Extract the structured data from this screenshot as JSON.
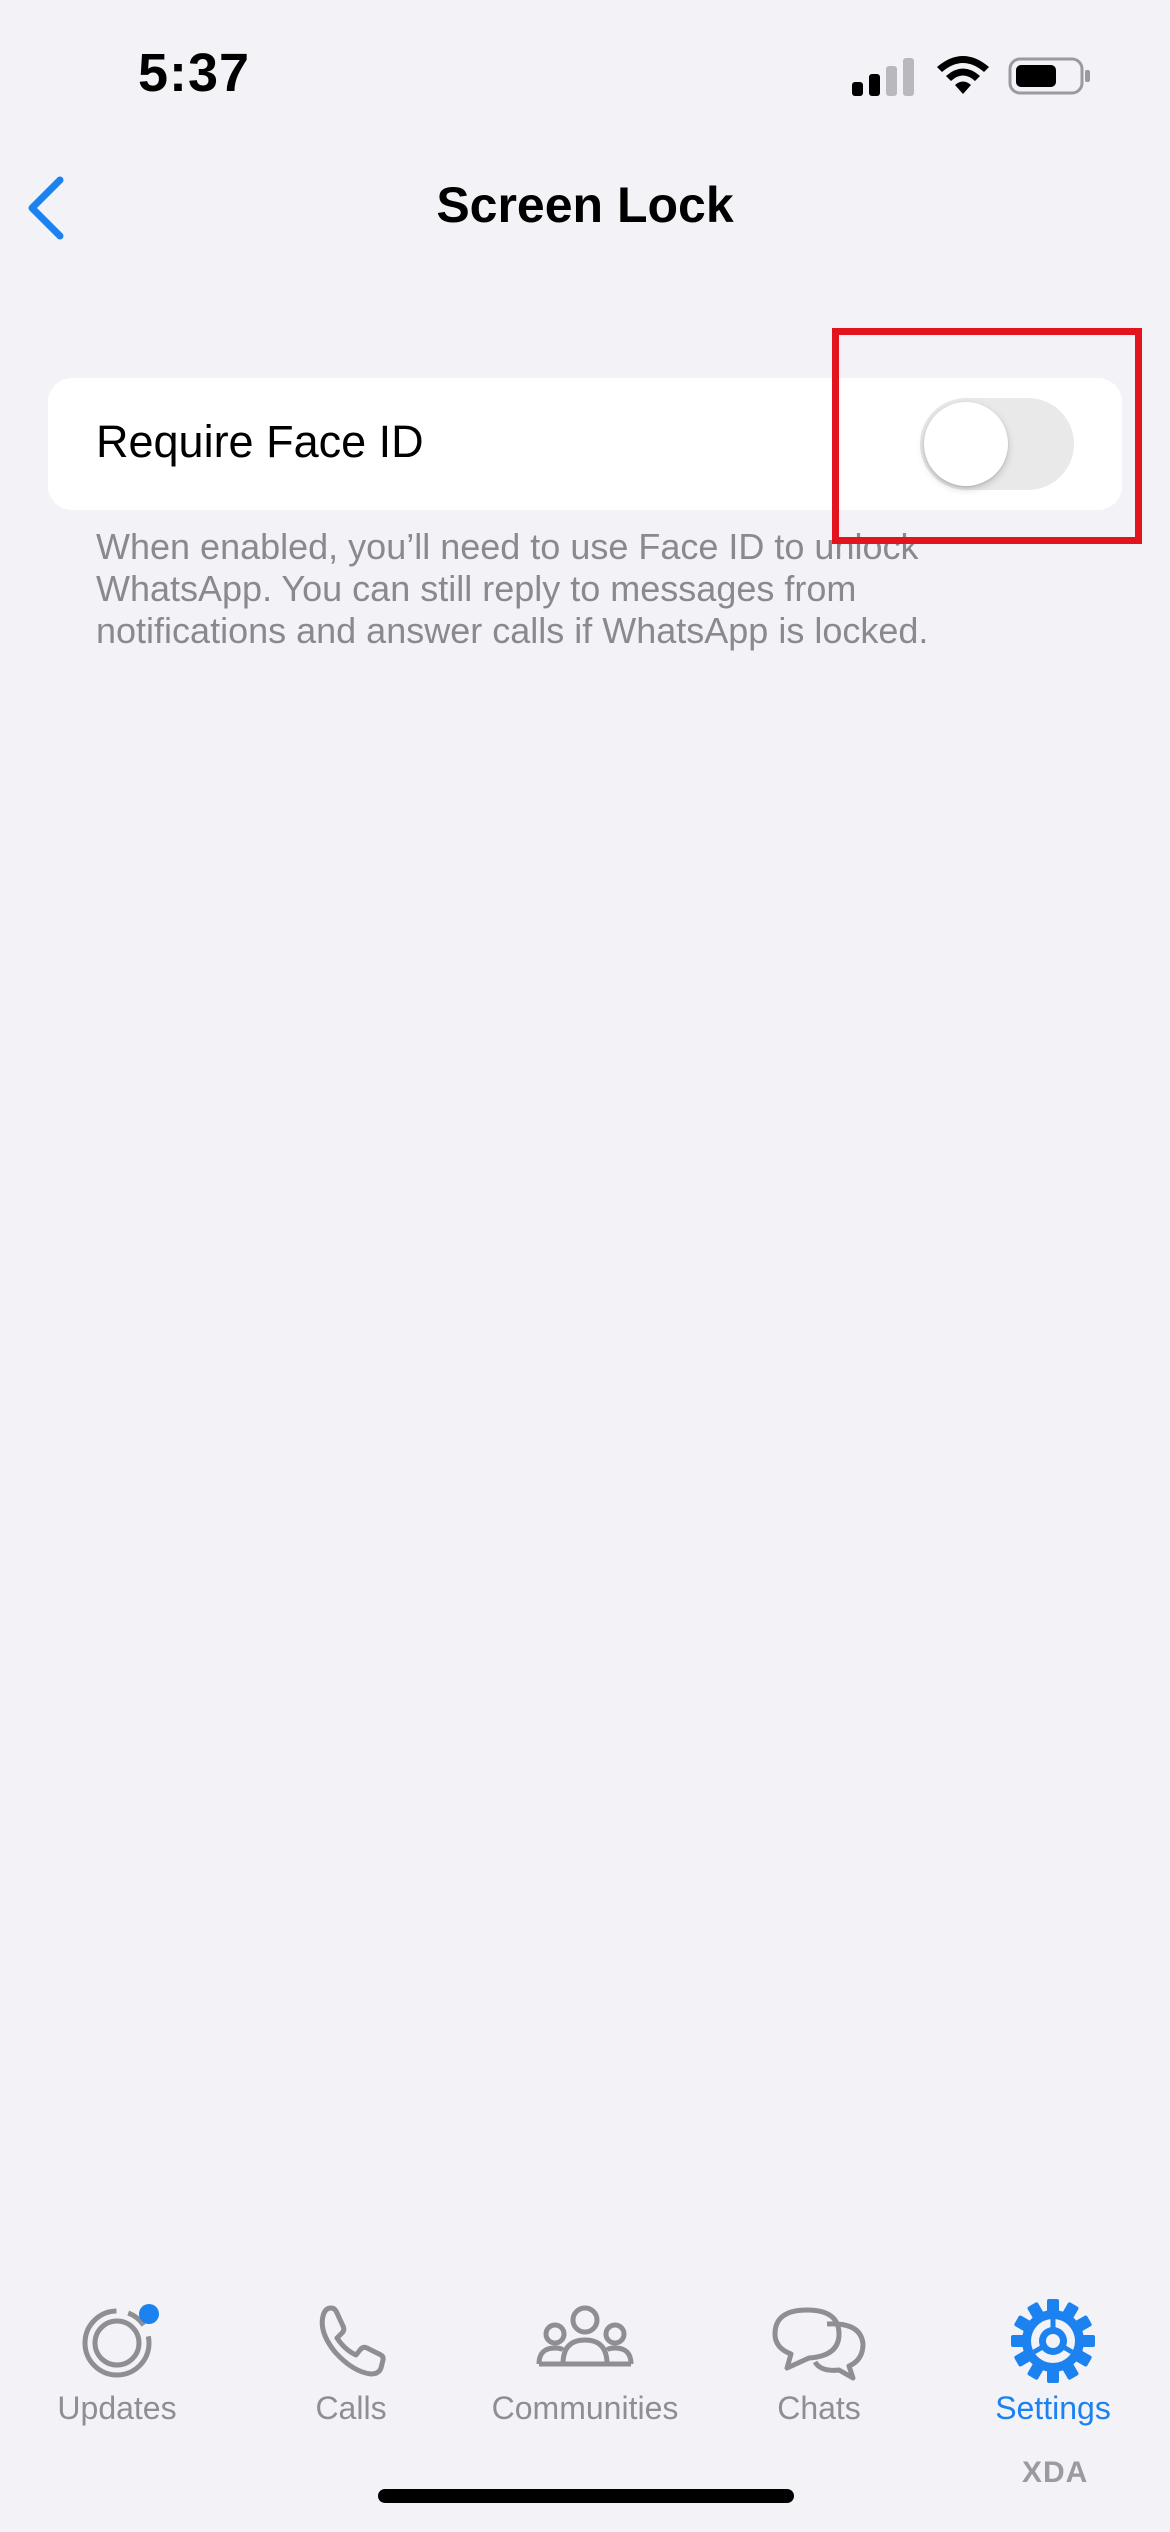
{
  "status_bar": {
    "time": "5:37"
  },
  "nav": {
    "title": "Screen Lock"
  },
  "settings": {
    "require_face_id_label": "Require Face ID",
    "require_face_id_enabled": false,
    "footnote": "When enabled, you’ll need to use Face ID to unlock WhatsApp. You can still reply to messages from notifications and answer calls if WhatsApp is locked."
  },
  "tabs": [
    {
      "label": "Updates",
      "icon": "updates-icon",
      "active": false
    },
    {
      "label": "Calls",
      "icon": "phone-icon",
      "active": false
    },
    {
      "label": "Communities",
      "icon": "communities-icon",
      "active": false
    },
    {
      "label": "Chats",
      "icon": "chats-icon",
      "active": false
    },
    {
      "label": "Settings",
      "icon": "settings-gear-icon",
      "active": true
    }
  ],
  "watermark": "XDA",
  "colors": {
    "accent": "#1b82f0",
    "highlight": "#e3141e",
    "background": "#f2f2f7",
    "secondary_text": "#8a8a8e"
  }
}
